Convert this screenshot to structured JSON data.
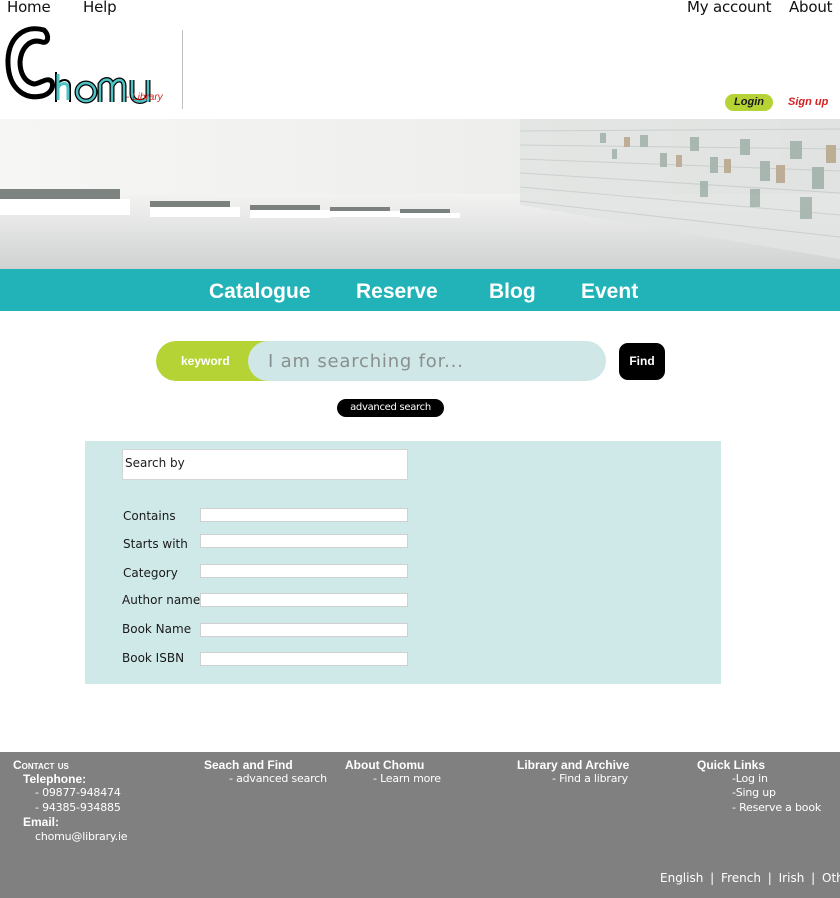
{
  "topnav": {
    "home": "Home",
    "help": "Help",
    "account": "My account",
    "about": "About"
  },
  "logo": {
    "name": "Chomu",
    "tagline": "- Library"
  },
  "auth": {
    "login": "Login",
    "signup": "Sign up"
  },
  "mainnav": {
    "catalogue": "Catalogue",
    "reserve": "Reserve",
    "blog": "Blog",
    "event": "Event"
  },
  "search": {
    "keyword_label": "keyword",
    "placeholder": "I am searching for...",
    "find": "Find",
    "advanced": "advanced search"
  },
  "form": {
    "search_by": "Search by",
    "fields": [
      "Contains",
      "Starts with",
      "Category",
      "Author name",
      "Book Name",
      "Book ISBN"
    ]
  },
  "footer": {
    "contact_title": "Contact us",
    "telephone_label": "Telephone:",
    "phones": [
      "- 09877-948474",
      "- 94385-934885"
    ],
    "email_label": "Email:",
    "email": "chomu@library.ie",
    "search_title": "Seach and Find",
    "search_link": "- advanced search",
    "about_title": "About Chomu",
    "about_link": "- Learn more",
    "library_title": "Library and Archive",
    "library_link": "- Find a library",
    "quick_title": "Quick Links",
    "quick_links": [
      "-Log in",
      "-Sing up",
      "- Reserve a book"
    ],
    "languages": [
      "English",
      "French",
      "Irish",
      "Other"
    ],
    "separator": "|"
  },
  "colors": {
    "teal": "#22b3b8",
    "lime": "#b5d334",
    "panel": "#cfe9e9",
    "footer": "#7f807f",
    "signup": "#d42020"
  }
}
